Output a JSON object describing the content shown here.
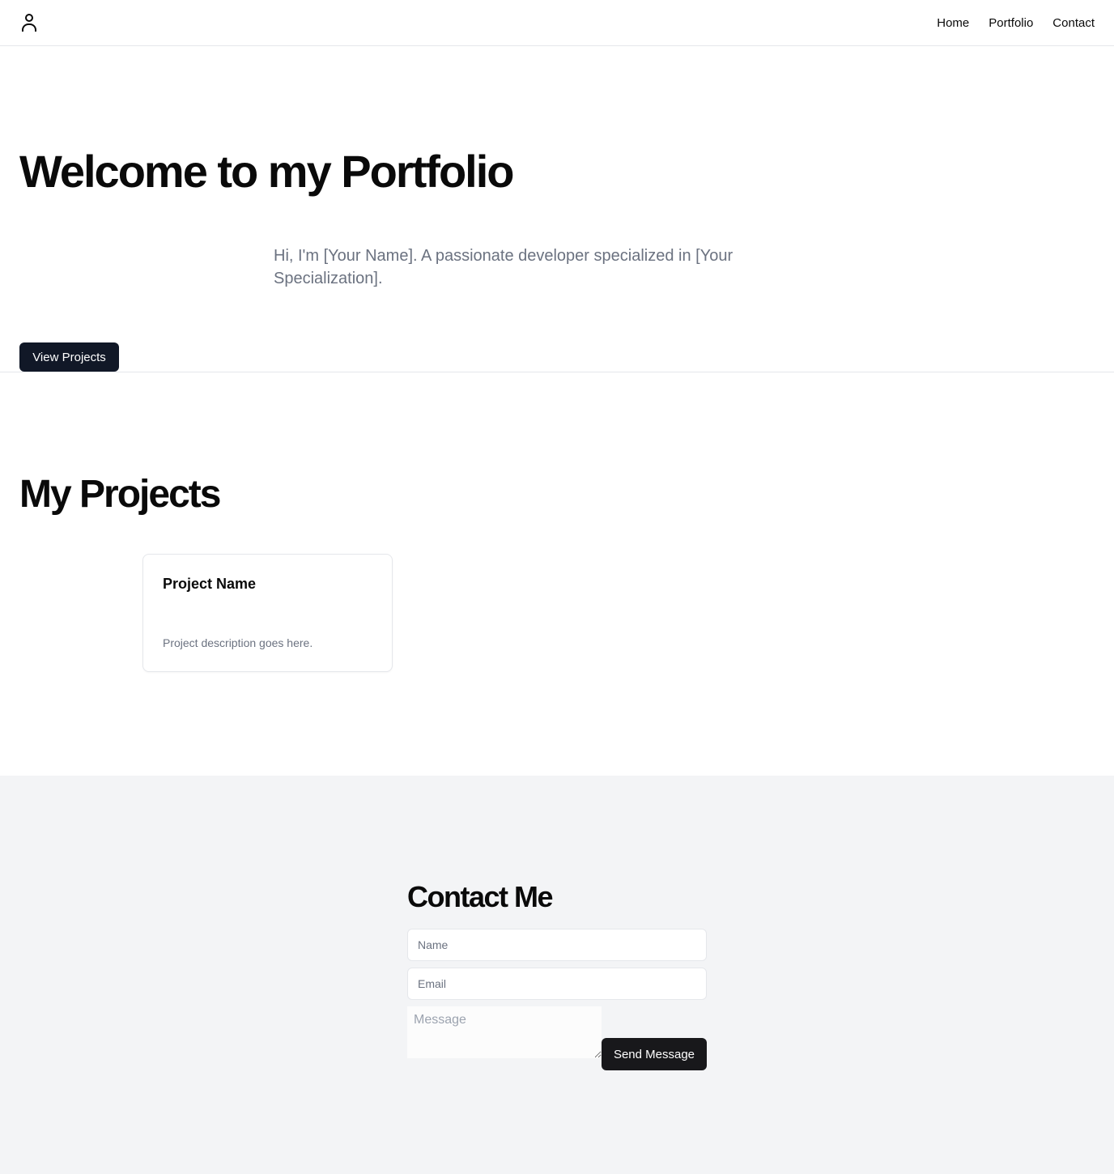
{
  "header": {
    "logo_icon": "user-icon",
    "nav": [
      {
        "label": "Home"
      },
      {
        "label": "Portfolio"
      },
      {
        "label": "Contact"
      }
    ]
  },
  "hero": {
    "title": "Welcome to my Portfolio",
    "subtitle": "Hi, I'm [Your Name]. A passionate developer specialized in [Your Specialization].",
    "cta_label": "View Projects"
  },
  "projects": {
    "title": "My Projects",
    "items": [
      {
        "name": "Project Name",
        "description": "Project description goes here."
      }
    ]
  },
  "contact": {
    "title": "Contact Me",
    "name_placeholder": "Name",
    "email_placeholder": "Email",
    "message_placeholder": "Message",
    "submit_label": "Send Message"
  },
  "colors": {
    "primary_button": "#111827",
    "send_button": "#18181b",
    "muted_text": "#6b7280",
    "contact_bg": "#f3f4f6",
    "border": "#e5e7eb"
  }
}
